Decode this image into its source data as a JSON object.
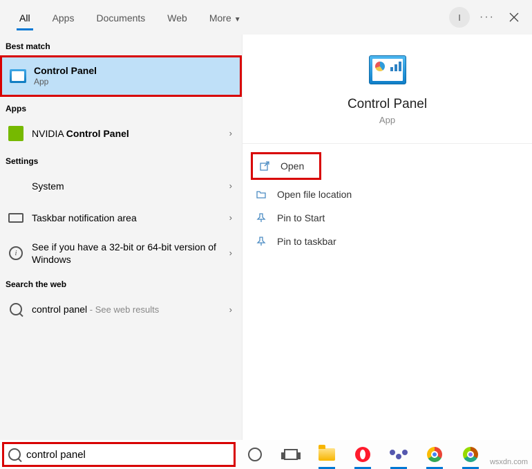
{
  "tabs": {
    "all": "All",
    "apps": "Apps",
    "documents": "Documents",
    "web": "Web",
    "more": "More"
  },
  "avatar_initial": "I",
  "sections": {
    "best_match": "Best match",
    "apps": "Apps",
    "settings": "Settings",
    "web": "Search the web"
  },
  "best_match": {
    "title": "Control Panel",
    "subtitle": "App"
  },
  "apps_list": [
    {
      "prefix": "NVIDIA ",
      "bold": "Control Panel"
    }
  ],
  "settings_list": [
    {
      "label": "System"
    },
    {
      "label": "Taskbar notification area"
    },
    {
      "label": "See if you have a 32-bit or 64-bit version of Windows"
    }
  ],
  "web_result": {
    "term": "control panel",
    "suffix": " - See web results"
  },
  "detail": {
    "title": "Control Panel",
    "subtitle": "App"
  },
  "actions": {
    "open": "Open",
    "file_location": "Open file location",
    "pin_start": "Pin to Start",
    "pin_taskbar": "Pin to taskbar"
  },
  "search_value": "control panel",
  "watermark": "wsxdn.com"
}
